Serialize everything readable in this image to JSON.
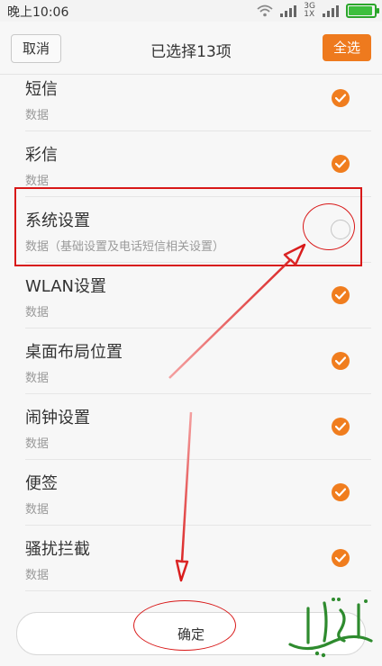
{
  "status": {
    "time": "晚上10:06",
    "network_top": "3G",
    "network_bottom": "1X"
  },
  "header": {
    "cancel_label": "取消",
    "title": "已选择13项",
    "select_all_label": "全选"
  },
  "items": [
    {
      "name": "短信",
      "sub": "数据",
      "checked": true
    },
    {
      "name": "彩信",
      "sub": "数据",
      "checked": true
    },
    {
      "name": "系统设置",
      "sub": "数据（基础设置及电话短信相关设置）",
      "checked": false
    },
    {
      "name": "WLAN设置",
      "sub": "数据",
      "checked": true
    },
    {
      "name": "桌面布局位置",
      "sub": "数据",
      "checked": true
    },
    {
      "name": "闹钟设置",
      "sub": "数据",
      "checked": true
    },
    {
      "name": "便签",
      "sub": "数据",
      "checked": true
    },
    {
      "name": "骚扰拦截",
      "sub": "数据",
      "checked": true
    }
  ],
  "confirm_label": "确定",
  "colors": {
    "accent": "#ee7a1e",
    "annotation": "#d81818",
    "watermark": "#2e8b2e"
  }
}
